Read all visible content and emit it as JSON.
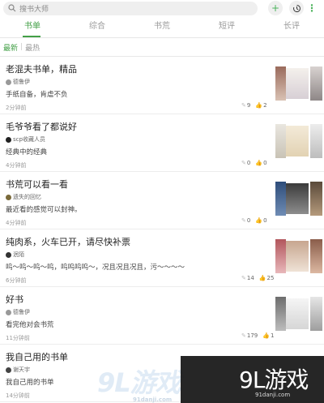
{
  "search": {
    "placeholder": "搜书大师"
  },
  "tabs": [
    "书单",
    "综合",
    "书荒",
    "短评",
    "长评"
  ],
  "subtabs": {
    "newest": "最新",
    "sep": "|",
    "hottest": "最热"
  },
  "items": [
    {
      "title": "老混夫书单，精品",
      "author": "德鲁伊",
      "desc": "手纸自备，肯虐不负",
      "time": "2分钟前",
      "comments": "9",
      "likes": "2"
    },
    {
      "title": "毛爷爷看了都说好",
      "author": "scp收藏人员",
      "desc": "经典中的经典",
      "time": "4分钟前",
      "comments": "0",
      "likes": "0"
    },
    {
      "title": "书荒可以看一看",
      "author": "遗失的回忆",
      "desc": "最近看的感觉可以封神。",
      "time": "4分钟前",
      "comments": "0",
      "likes": "0"
    },
    {
      "title": "纯肉系，火车已开，请尽快补票",
      "author": "泯陌",
      "desc": "呜～呜～呜～呜，呜呜呜呜～，况且况且况且，污～～～～",
      "time": "6分钟前",
      "comments": "14",
      "likes": "25"
    },
    {
      "title": "好书",
      "author": "德鲁伊",
      "desc": "看完他对会书荒",
      "time": "11分钟前",
      "comments": "179",
      "likes": "1"
    },
    {
      "title": "我自己用的书单",
      "author": "谢天宇",
      "desc": "我自己用的书单",
      "time": "14分钟前",
      "comments": "",
      "likes": ""
    }
  ],
  "watermark": {
    "logo_left": "9L游戏",
    "url_left": "91danji.com",
    "logo_right": "9L游戏",
    "url_right": "91danji.com"
  },
  "colors": {
    "accent": "#43a047"
  }
}
